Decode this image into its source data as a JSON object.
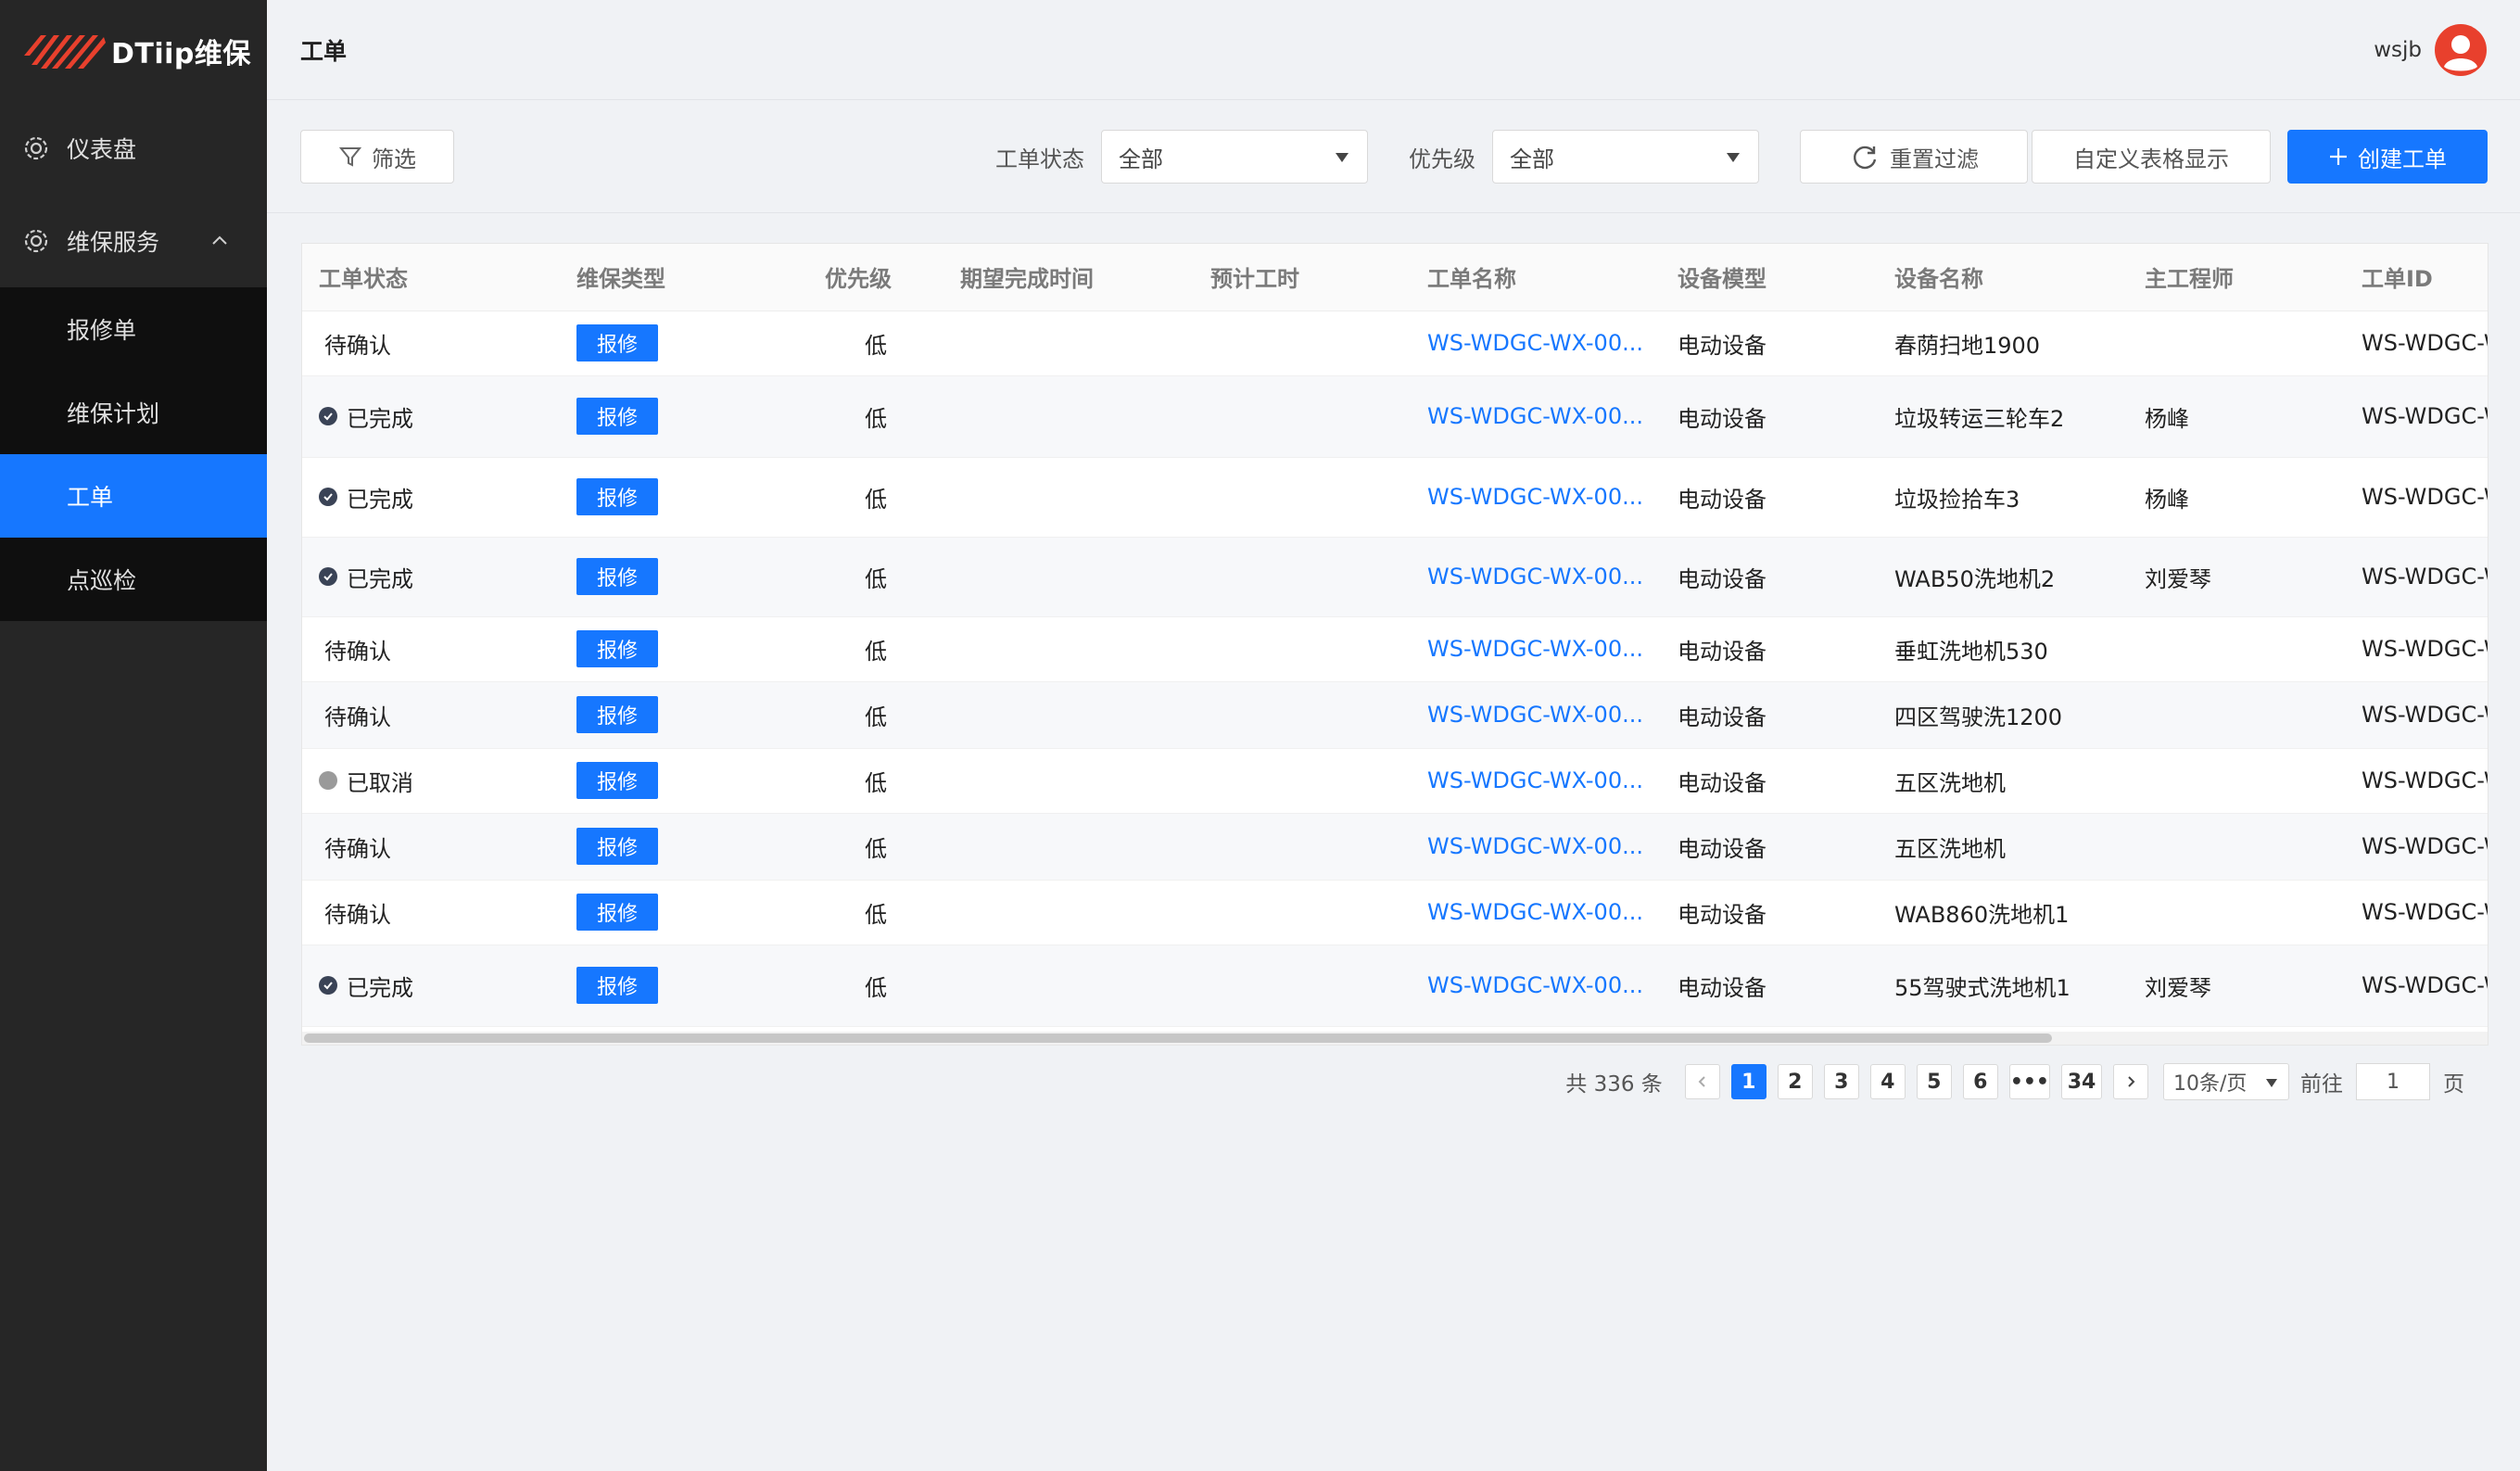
{
  "sidebar": {
    "logo_text": "DTiip维保",
    "dashboard": "仪表盘",
    "service": "维保服务",
    "items": [
      "报修单",
      "维保计划",
      "工单",
      "点巡检"
    ]
  },
  "header": {
    "title": "工单",
    "username": "wsjb"
  },
  "filters": {
    "filter_btn": "筛选",
    "status_label": "工单状态",
    "status_value": "全部",
    "priority_label": "优先级",
    "priority_value": "全部",
    "reset_btn": "重置过滤",
    "custom_btn": "自定义表格显示",
    "create_btn": "创建工单"
  },
  "table": {
    "columns": [
      "工单状态",
      "维保类型",
      "优先级",
      "期望完成时间",
      "预计工时",
      "工单名称",
      "设备模型",
      "设备名称",
      "主工程师",
      "工单ID"
    ],
    "rows": [
      {
        "status": "待确认",
        "mark": "none",
        "type": "报修",
        "priority": "低",
        "expected": "",
        "hours": "",
        "name": "WS-WDGC-WX-00...",
        "model": "电动设备",
        "device": "春荫扫地1900",
        "engineer": "",
        "id": "WS-WDGC-W"
      },
      {
        "status": "已完成",
        "mark": "ok",
        "type": "报修",
        "priority": "低",
        "expected": "",
        "hours": "",
        "name": "WS-WDGC-WX-00...",
        "model": "电动设备",
        "device": "垃圾转运三轮车2",
        "engineer": "杨峰",
        "id": "WS-WDGC-W"
      },
      {
        "status": "已完成",
        "mark": "ok",
        "type": "报修",
        "priority": "低",
        "expected": "",
        "hours": "",
        "name": "WS-WDGC-WX-00...",
        "model": "电动设备",
        "device": "垃圾捡拾车3",
        "engineer": "杨峰",
        "id": "WS-WDGC-W"
      },
      {
        "status": "已完成",
        "mark": "ok",
        "type": "报修",
        "priority": "低",
        "expected": "",
        "hours": "",
        "name": "WS-WDGC-WX-00...",
        "model": "电动设备",
        "device": "WAB50洗地机2",
        "engineer": "刘爱琴",
        "id": "WS-WDGC-W"
      },
      {
        "status": "待确认",
        "mark": "none",
        "type": "报修",
        "priority": "低",
        "expected": "",
        "hours": "",
        "name": "WS-WDGC-WX-00...",
        "model": "电动设备",
        "device": "垂虹洗地机530",
        "engineer": "",
        "id": "WS-WDGC-W"
      },
      {
        "status": "待确认",
        "mark": "none",
        "type": "报修",
        "priority": "低",
        "expected": "",
        "hours": "",
        "name": "WS-WDGC-WX-00...",
        "model": "电动设备",
        "device": "四区驾驶洗1200",
        "engineer": "",
        "id": "WS-WDGC-W"
      },
      {
        "status": "已取消",
        "mark": "cancel",
        "type": "报修",
        "priority": "低",
        "expected": "",
        "hours": "",
        "name": "WS-WDGC-WX-00...",
        "model": "电动设备",
        "device": "五区洗地机",
        "engineer": "",
        "id": "WS-WDGC-W"
      },
      {
        "status": "待确认",
        "mark": "none",
        "type": "报修",
        "priority": "低",
        "expected": "",
        "hours": "",
        "name": "WS-WDGC-WX-00...",
        "model": "电动设备",
        "device": "五区洗地机",
        "engineer": "",
        "id": "WS-WDGC-W"
      },
      {
        "status": "待确认",
        "mark": "none",
        "type": "报修",
        "priority": "低",
        "expected": "",
        "hours": "",
        "name": "WS-WDGC-WX-00...",
        "model": "电动设备",
        "device": "WAB860洗地机1",
        "engineer": "",
        "id": "WS-WDGC-W"
      },
      {
        "status": "已完成",
        "mark": "ok",
        "type": "报修",
        "priority": "低",
        "expected": "",
        "hours": "",
        "name": "WS-WDGC-WX-00...",
        "model": "电动设备",
        "device": "55驾驶式洗地机1",
        "engineer": "刘爱琴",
        "id": "WS-WDGC-W"
      }
    ]
  },
  "pagination": {
    "total": "共 336 条",
    "pages": [
      "1",
      "2",
      "3",
      "4",
      "5",
      "6"
    ],
    "ellipsis": "•••",
    "last": "34",
    "page_size": "10条/页",
    "goto_label": "前往",
    "goto_value": "1",
    "page_suffix": "页"
  },
  "colors": {
    "primary": "#1677ff",
    "sidebar": "#262626",
    "logo_red": "#e8402d"
  },
  "icons": [
    "logo-stripes-icon",
    "gear-icon",
    "chevron-up-icon",
    "funnel-icon",
    "refresh-icon",
    "plus-icon",
    "check-circle-icon",
    "chevron-left-icon",
    "chevron-right-icon",
    "user-avatar-icon"
  ]
}
